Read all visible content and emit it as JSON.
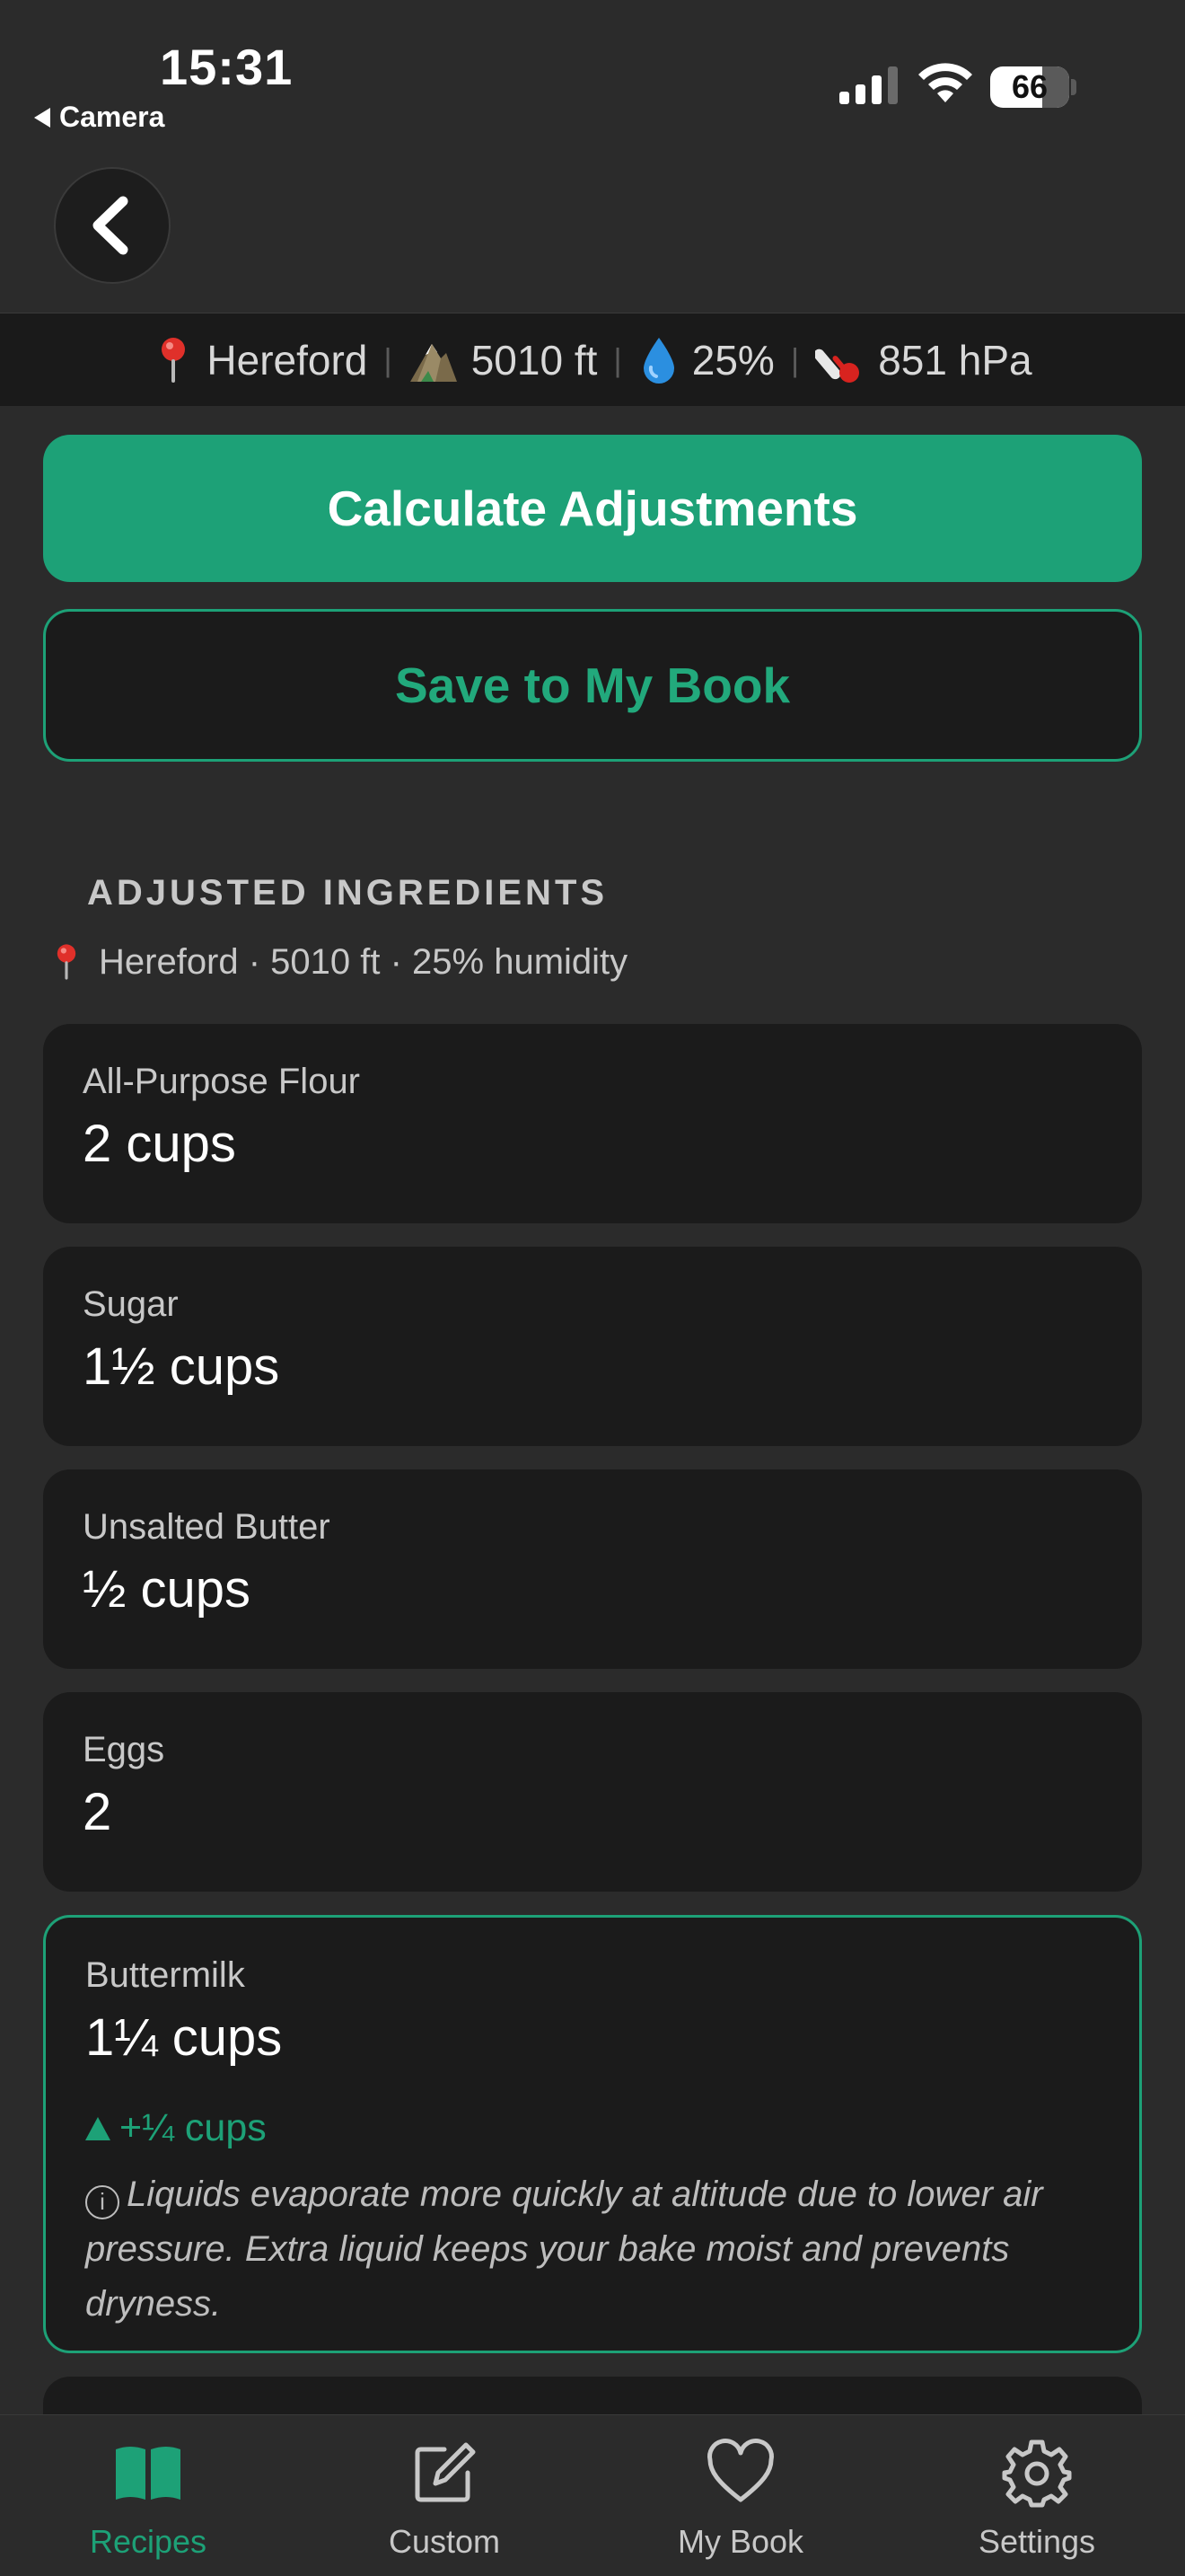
{
  "status_bar": {
    "time": "15:31",
    "back_app": "Camera",
    "battery": "66"
  },
  "nav": {
    "back_icon": "chevron-left-icon"
  },
  "conditions": {
    "location": "Hereford",
    "altitude": "5010 ft",
    "humidity": "25%",
    "pressure": "851 hPa",
    "separator": "|"
  },
  "actions": {
    "calculate_label": "Calculate Adjustments",
    "save_label": "Save to My Book"
  },
  "adjusted": {
    "title": "ADJUSTED INGREDIENTS",
    "subtitle": "Hereford · 5010 ft · 25% humidity",
    "ingredients": [
      {
        "name": "All-Purpose Flour",
        "amount": "2 cups"
      },
      {
        "name": "Sugar",
        "amount": "1½ cups"
      },
      {
        "name": "Unsalted Butter",
        "amount": "½ cups"
      },
      {
        "name": "Eggs",
        "amount": "2"
      },
      {
        "name": "Buttermilk",
        "amount": "1¼ cups",
        "delta": "+¼ cups",
        "note": "Liquids evaporate more quickly at altitude due to lower air pressure. Extra liquid keeps your bake moist and prevents dryness."
      }
    ]
  },
  "tabs": [
    {
      "label": "Recipes",
      "icon": "book-icon",
      "active": true
    },
    {
      "label": "Custom",
      "icon": "edit-square-icon",
      "active": false
    },
    {
      "label": "My Book",
      "icon": "heart-icon",
      "active": false
    },
    {
      "label": "Settings",
      "icon": "gear-icon",
      "active": false
    }
  ],
  "colors": {
    "accent": "#1da177",
    "background": "#2b2b2b",
    "card": "#1b1b1b"
  }
}
